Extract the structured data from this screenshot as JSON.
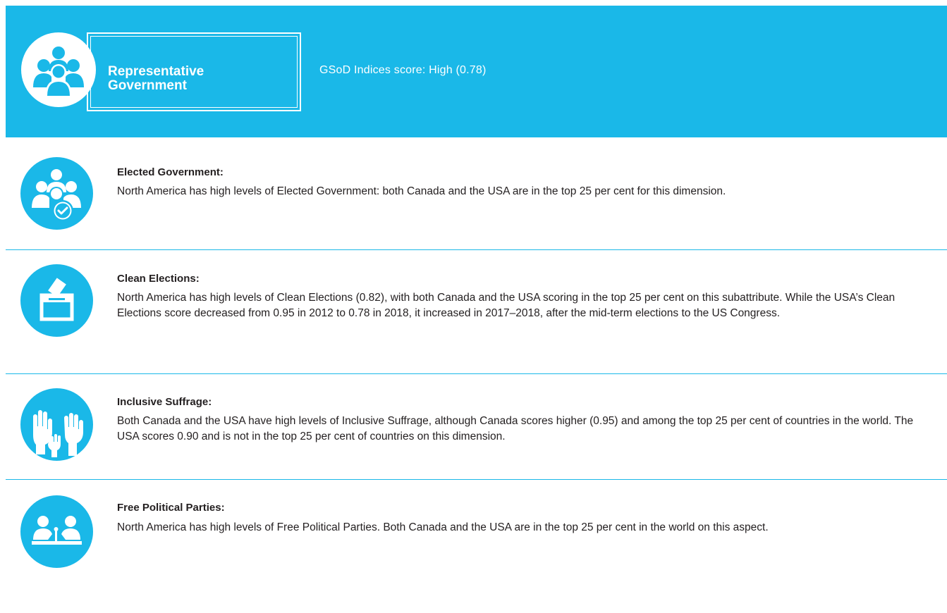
{
  "header": {
    "title": "Representative Government",
    "score": "GSoD Indices score: High (0.78)",
    "icon": "people-group-icon"
  },
  "sections": [
    {
      "title": "Elected Government:",
      "body": "North America has high levels of Elected Government: both Canada and the USA are in the top 25 per cent for this dimension.",
      "icon": "people-check-icon"
    },
    {
      "title": "Clean Elections:",
      "body": "North America has high levels of Clean Elections (0.82), with both Canada and the USA scoring in the top 25 per cent on this subattribute. While the USA’s Clean Elections score decreased from 0.95 in 2012 to 0.78 in 2018, it increased in 2017–2018, after the mid-term elections to the US Congress.",
      "icon": "ballot-box-icon"
    },
    {
      "title": "Inclusive Suffrage:",
      "body": "Both Canada and the USA have high levels of Inclusive Suffrage, although Canada scores higher (0.95) and among the top 25 per cent of countries in the world. The USA scores 0.90 and is not in the top 25 per cent of countries on this dimension.",
      "icon": "raised-hands-icon"
    },
    {
      "title": "Free Political Parties:",
      "body": "North America has high levels of Free Political Parties. Both Canada and the USA are in the top 25 per cent in the world on this aspect.",
      "icon": "podium-speakers-icon"
    }
  ],
  "colors": {
    "accent": "#1ab8e8",
    "text": "#231f20",
    "background": "#ffffff"
  }
}
